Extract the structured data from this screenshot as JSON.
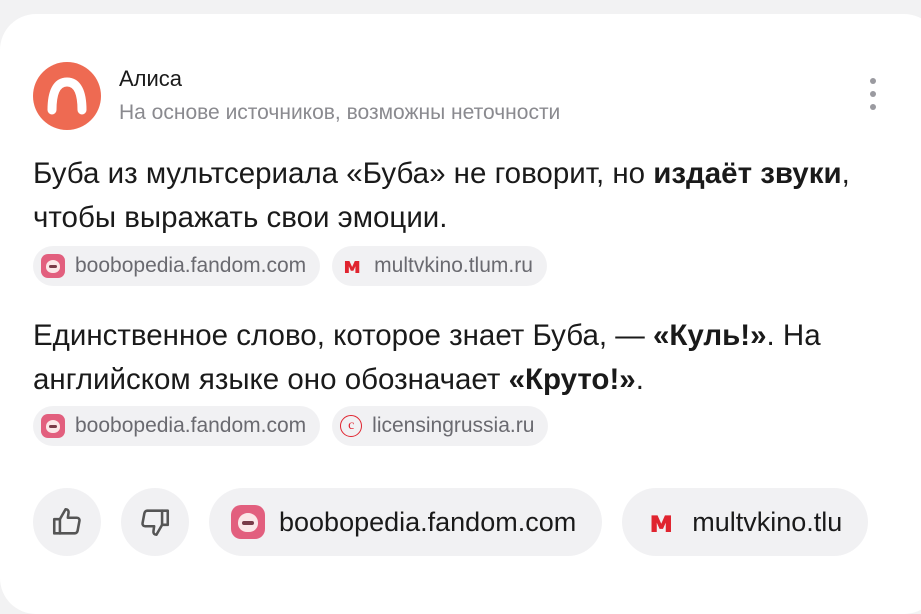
{
  "header": {
    "title": "Алиса",
    "subtitle": "На основе источников, возможны неточности"
  },
  "paragraphs": [
    {
      "parts": [
        {
          "text": "Буба из мультсериала «Буба» не говорит, но ",
          "bold": false
        },
        {
          "text": "издаёт звуки",
          "bold": true
        },
        {
          "text": ", чтобы выражать свои эмоции.",
          "bold": false
        }
      ],
      "sources": [
        {
          "label": "boobopedia.fandom.com",
          "icon": "booba-favicon-icon"
        },
        {
          "label": "multvkino.tlum.ru",
          "icon": "m-favicon-icon"
        }
      ]
    },
    {
      "parts": [
        {
          "text": "Единственное слово, которое знает Буба, — ",
          "bold": false
        },
        {
          "text": "«Куль!»",
          "bold": true
        },
        {
          "text": ". На английском языке оно обозначает ",
          "bold": false
        },
        {
          "text": "«Круто!»",
          "bold": true
        },
        {
          "text": ".",
          "bold": false
        }
      ],
      "sources": [
        {
          "label": "boobopedia.fandom.com",
          "icon": "booba-favicon-icon"
        },
        {
          "label": "licensingrussia.ru",
          "icon": "c-favicon-icon"
        }
      ]
    }
  ],
  "bottom": {
    "like_icon": "thumbs-up-icon",
    "dislike_icon": "thumbs-down-icon",
    "sources": [
      {
        "label": "boobopedia.fandom.com",
        "icon": "booba-favicon-icon"
      },
      {
        "label": "multvkino.tlu",
        "icon": "m-favicon-icon"
      }
    ]
  },
  "colors": {
    "brand": "#ee6a52",
    "chip_background": "#f1f1f3",
    "muted_text": "#8a8a8f"
  }
}
